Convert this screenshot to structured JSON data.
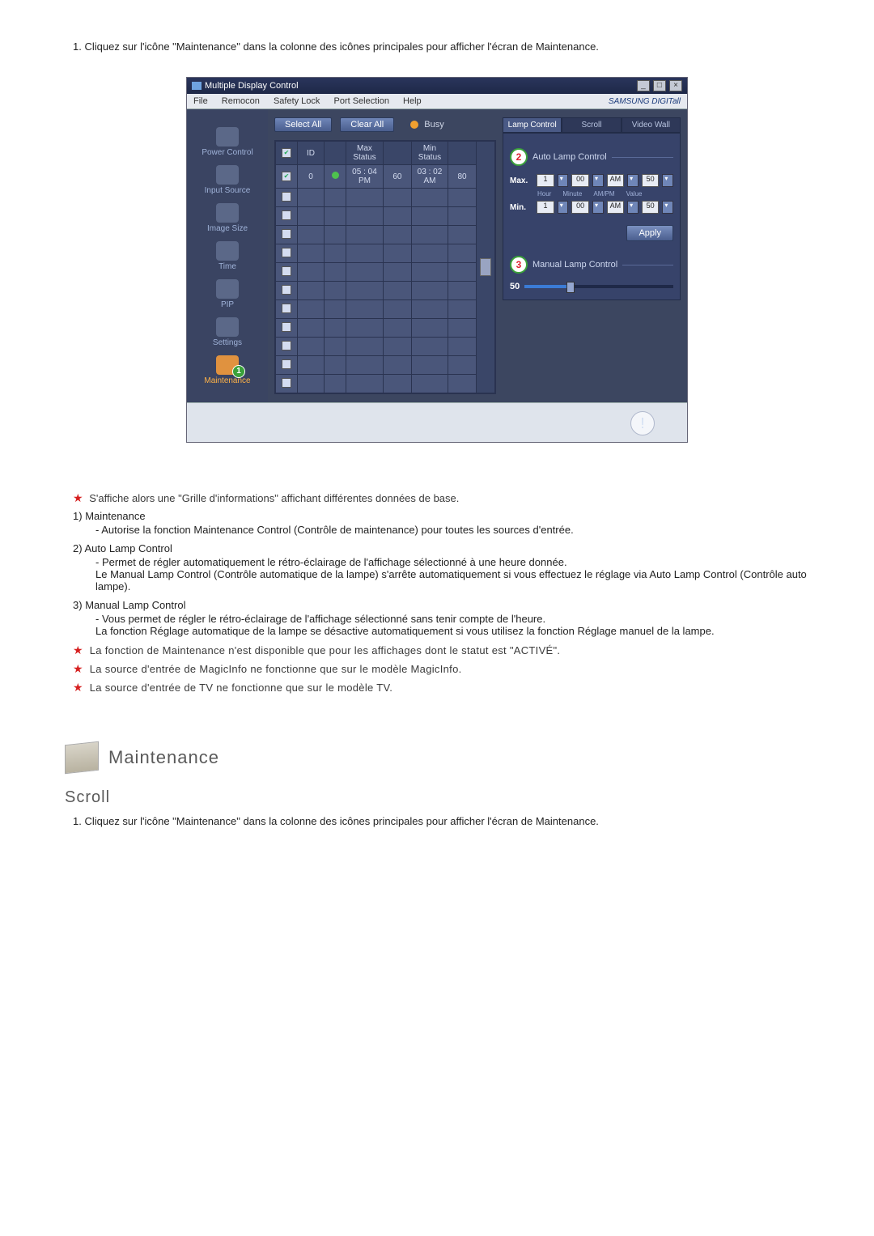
{
  "intro_num": "1.",
  "intro_text": "Cliquez sur l'icône \"Maintenance\" dans la colonne des icônes principales pour afficher l'écran de Maintenance.",
  "app": {
    "title": "Multiple Display Control",
    "menu": [
      "File",
      "Remocon",
      "Safety Lock",
      "Port Selection",
      "Help"
    ],
    "brand": "SAMSUNG DIGITall",
    "select_all": "Select All",
    "clear_all": "Clear All",
    "busy": "Busy",
    "sidebar": [
      {
        "label": "Power Control"
      },
      {
        "label": "Input Source"
      },
      {
        "label": "Image Size"
      },
      {
        "label": "Time"
      },
      {
        "label": "PIP"
      },
      {
        "label": "Settings"
      },
      {
        "label": "Maintenance",
        "active": true,
        "badge": "1"
      }
    ],
    "grid": {
      "headers": [
        "",
        "ID",
        "",
        "Max Status",
        "",
        "Min Status",
        ""
      ],
      "row": {
        "id": "0",
        "max_time": "05 : 04 PM",
        "max_val": "60",
        "min_time": "03 : 02 AM",
        "min_val": "80"
      }
    },
    "tabs": [
      "Lamp Control",
      "Scroll",
      "Video Wall"
    ],
    "auto_lamp": {
      "badge": "2",
      "title": "Auto Lamp Control",
      "max_label": "Max.",
      "min_label": "Min.",
      "hour": "1",
      "minute": "00",
      "ampm": "AM",
      "value": "50",
      "sub": [
        "Hour",
        "Minute",
        "AM/PM",
        "Value"
      ],
      "apply": "Apply"
    },
    "manual_lamp": {
      "badge": "3",
      "title": "Manual Lamp Control",
      "value": "50"
    }
  },
  "below": {
    "star1": "S'affiche alors une \"Grille d'informations\" affichant différentes données de base.",
    "items": [
      {
        "num": "1)",
        "title": "Maintenance",
        "body": "- Autorise la fonction Maintenance Control (Contrôle de maintenance) pour toutes les sources d'entrée."
      },
      {
        "num": "2)",
        "title": "Auto Lamp Control",
        "body": "- Permet de régler automatiquement le rétro-éclairage de l'affichage sélectionné à une heure donnée.\nLe Manual Lamp Control (Contrôle automatique de la lampe) s'arrête automatiquement si vous effectuez le réglage via Auto Lamp Control (Contrôle auto lampe)."
      },
      {
        "num": "3)",
        "title": "Manual Lamp Control",
        "body": "- Vous permet de régler le rétro-éclairage de l'affichage sélectionné sans tenir compte de l'heure.\nLa fonction Réglage automatique de la lampe se désactive automatiquement si vous utilisez la fonction Réglage manuel de la lampe."
      }
    ],
    "star2": "La fonction de Maintenance n'est disponible que pour les affichages dont le statut est \"ACTIVÉ\".",
    "star3": "La source d'entrée de MagicInfo ne fonctionne que sur le modèle MagicInfo.",
    "star4": "La source d'entrée de TV ne fonctionne que sur le modèle TV."
  },
  "section2": {
    "heading": "Maintenance",
    "sub": "Scroll",
    "intro_num": "1.",
    "intro_text": "Cliquez sur l'icône \"Maintenance\" dans la colonne des icônes principales pour afficher l'écran de Maintenance."
  }
}
